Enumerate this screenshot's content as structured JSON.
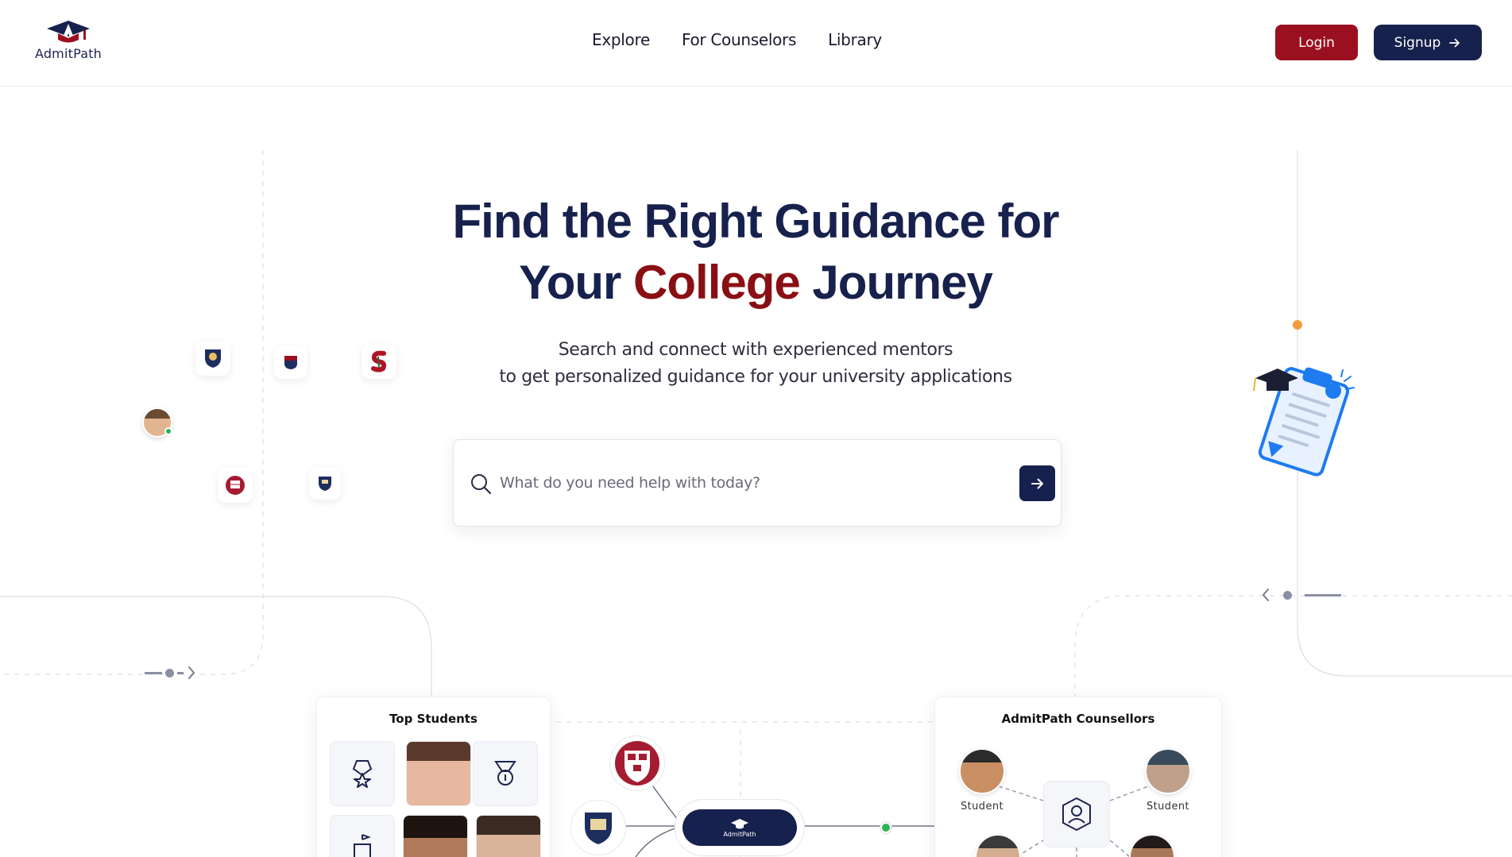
{
  "brand": {
    "name": "AdmitPath"
  },
  "nav": {
    "items": [
      "Explore",
      "For Counselors",
      "Library"
    ],
    "login_label": "Login",
    "signup_label": "Signup"
  },
  "hero": {
    "title_line1": "Find the Right Guidance for",
    "title_line2_pre": "Your ",
    "title_line2_accent": "College",
    "title_line2_post": " Journey",
    "subtitle_line1": "Search and connect with experienced mentors",
    "subtitle_line2": "to get personalized guidance for your university applications"
  },
  "search": {
    "placeholder": "What do you need help with today?",
    "value": ""
  },
  "cards": {
    "students_title": "Top Students",
    "counsellors_title": "AdmitPath Counsellors",
    "student_label_left": "Student",
    "student_label_right": "Student",
    "hub_label": "AdmitPath"
  },
  "colors": {
    "navy": "#17214d",
    "accent_red": "#8a0f14",
    "login_red": "#9b1020",
    "orange": "#f39a3d"
  },
  "icons": [
    "search-icon",
    "arrow-right-icon",
    "medal-icon",
    "ribbon-badge-icon",
    "building-icon",
    "user-hexagon-icon",
    "clipboard-illustration",
    "chevron-left-icon",
    "chevron-right-icon"
  ]
}
